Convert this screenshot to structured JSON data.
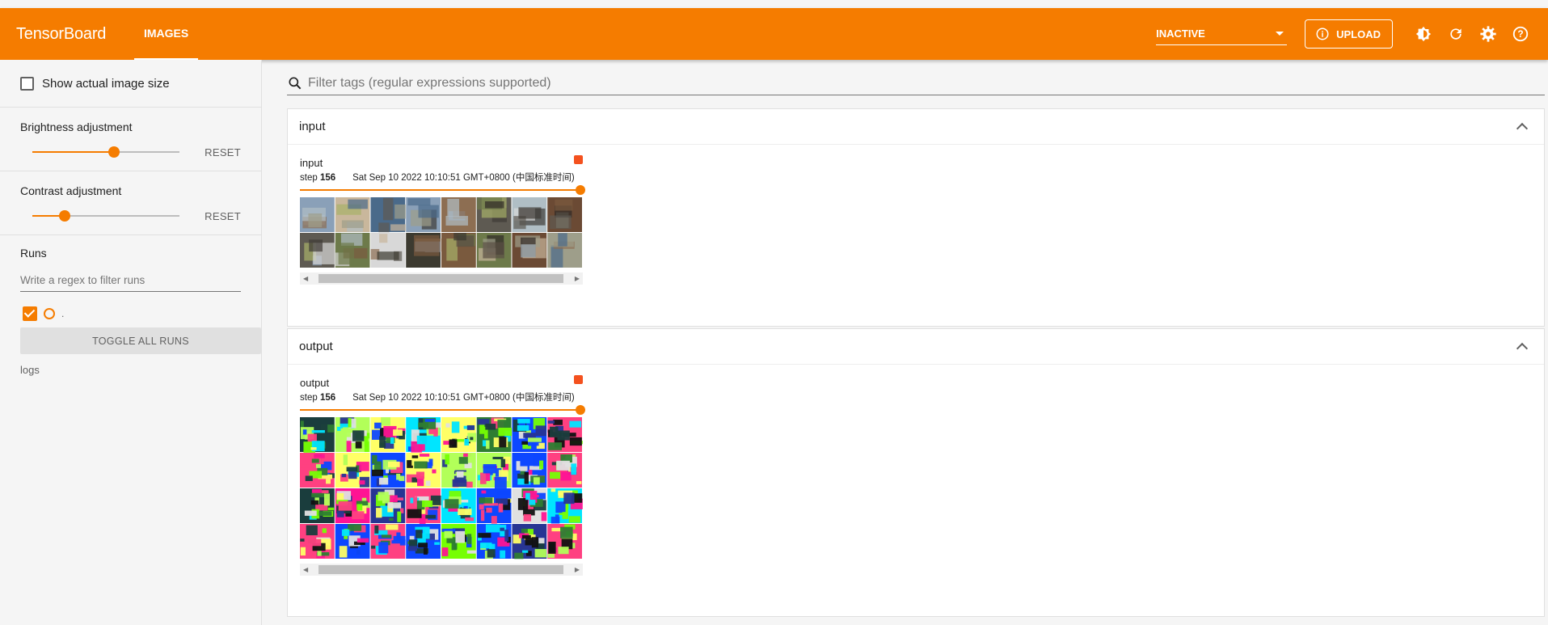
{
  "appbar": {
    "brand": "TensorBoard",
    "tab": "IMAGES",
    "status_select": "INACTIVE",
    "upload_label": "UPLOAD",
    "accent": "#f57c00"
  },
  "sidebar": {
    "show_actual_size_label": "Show actual image size",
    "brightness_label": "Brightness adjustment",
    "brightness_value": 0.5,
    "contrast_label": "Contrast adjustment",
    "contrast_value": 0.2,
    "reset_label": "RESET",
    "runs_label": "Runs",
    "runs_filter_placeholder": "Write a regex to filter runs",
    "run_name": ".",
    "toggle_all_label": "TOGGLE ALL RUNS",
    "run_label": "logs"
  },
  "main": {
    "filter_placeholder": "Filter tags (regular expressions supported)",
    "cards": [
      {
        "title": "input",
        "tile_name": "input",
        "step_label": "step",
        "step": "156",
        "timestamp": "Sat Sep 10 2022 10:10:51 GMT+0800 (中国标准时间)",
        "rows": 2
      },
      {
        "title": "output",
        "tile_name": "output",
        "step_label": "step",
        "step": "156",
        "timestamp": "Sat Sep 10 2022 10:10:51 GMT+0800 (中国标准时间)",
        "rows": 4
      }
    ]
  }
}
